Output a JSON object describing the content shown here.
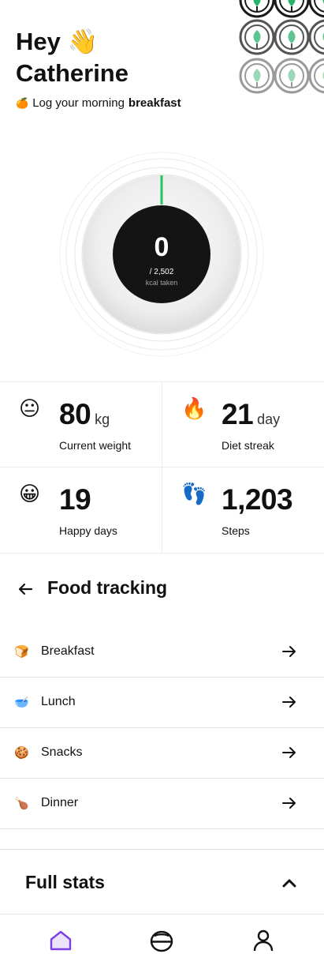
{
  "header": {
    "greeting_line1": "Hey",
    "wave_emoji": "👋",
    "greeting_line2": "Catherine",
    "sub_emoji": "🍊",
    "sub_text": "Log your morning",
    "sub_bold": "breakfast"
  },
  "calories": {
    "value": "0",
    "goal": "/ 2,502",
    "caption": "kcal taken",
    "progress_fraction": 0
  },
  "stats": [
    {
      "emoji": "😐",
      "value": "80",
      "unit": "kg",
      "label": "Current weight"
    },
    {
      "emoji": "🔥",
      "value": "21",
      "unit": "day",
      "label": "Diet streak"
    },
    {
      "emoji": "😀",
      "value": "19",
      "unit": "",
      "label": "Happy days"
    },
    {
      "emoji": "👣",
      "value": "1,203",
      "unit": "",
      "label": "Steps"
    }
  ],
  "food_tracking": {
    "title": "Food tracking",
    "meals": [
      {
        "icon": "🍞",
        "label": "Breakfast"
      },
      {
        "icon": "🥣",
        "label": "Lunch"
      },
      {
        "icon": "🍪",
        "label": "Snacks"
      },
      {
        "icon": "🍗",
        "label": "Dinner"
      }
    ]
  },
  "full_stats": {
    "title": "Full stats"
  },
  "colors": {
    "accent": "#22c55e",
    "nav_active": "#7b3fe4",
    "dark": "#111111"
  },
  "icons": {
    "back": "arrow-left-icon",
    "meal_arrow": "arrow-right-icon",
    "chevron": "chevron-up-icon",
    "nav": [
      "home-icon",
      "bowl-icon",
      "profile-icon"
    ]
  }
}
